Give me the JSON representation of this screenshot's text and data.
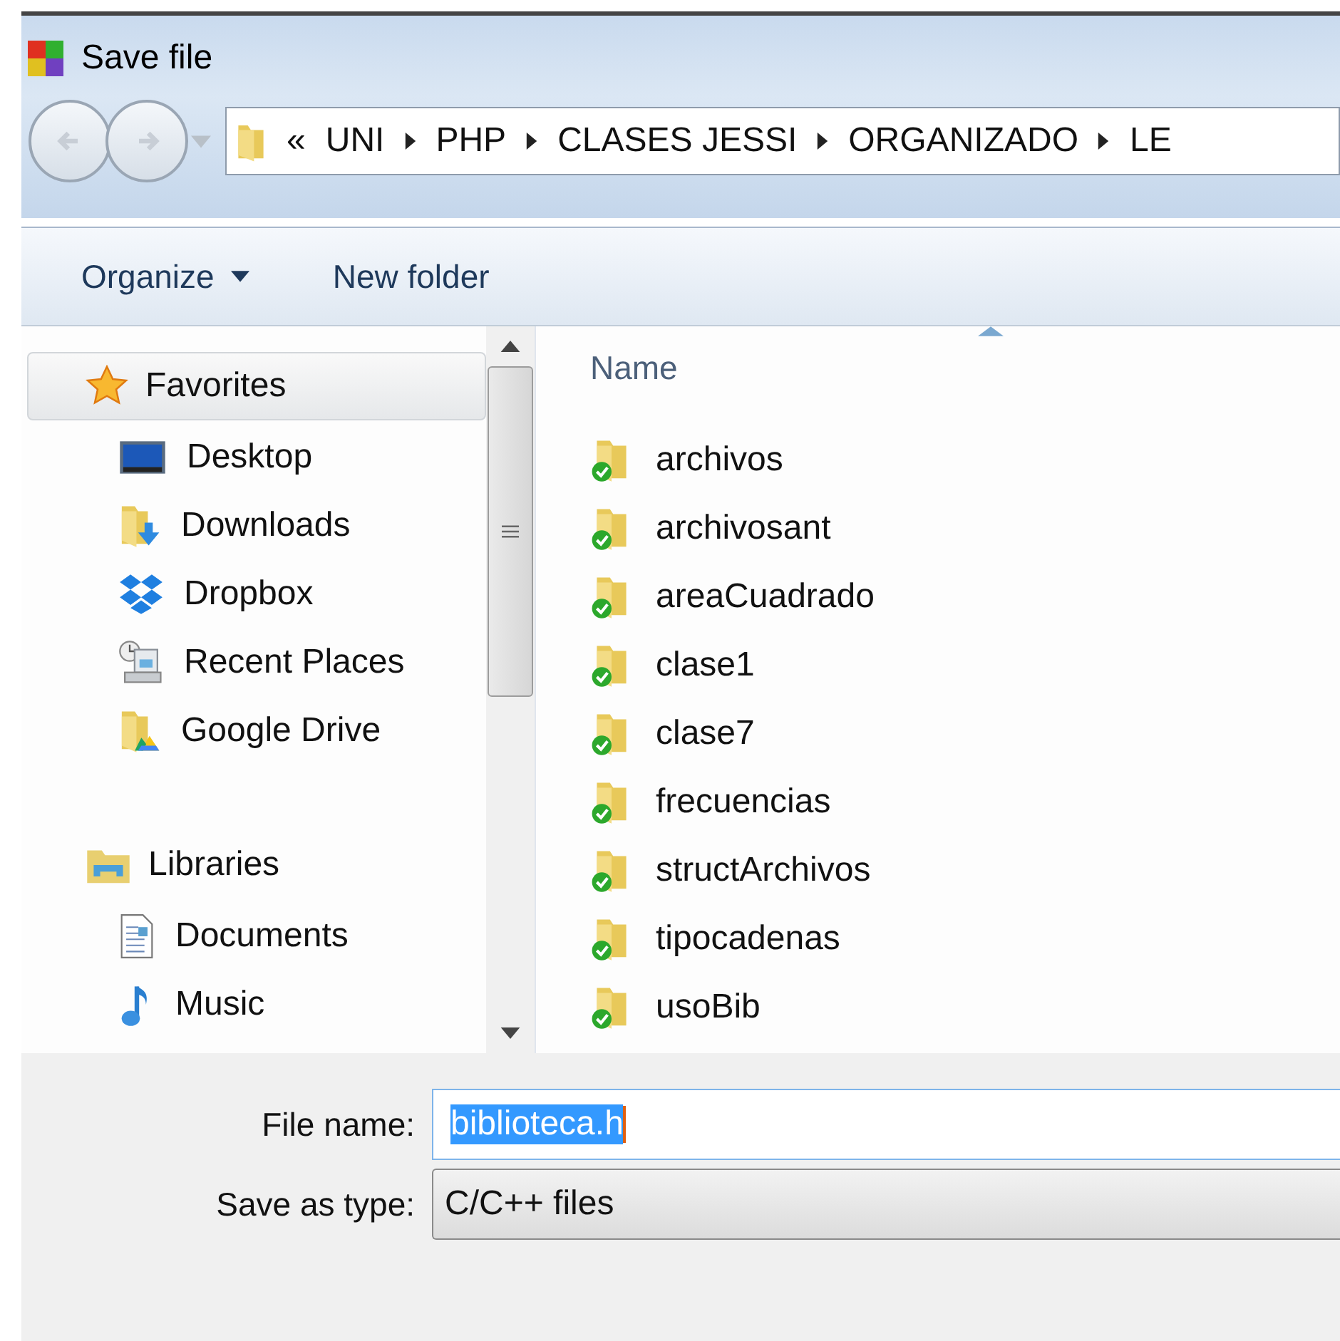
{
  "window": {
    "title": "Save file"
  },
  "address": {
    "overflow": "«",
    "path": [
      "UNI",
      "PHP",
      "CLASES JESSI",
      "ORGANIZADO",
      "LE"
    ]
  },
  "toolbar": [
    {
      "label": "Organize",
      "has_menu": true
    },
    {
      "label": "New folder",
      "has_menu": false
    }
  ],
  "sidebar": {
    "sections": [
      {
        "label": "Favorites",
        "kind": "favorites",
        "selected": true,
        "items": [
          {
            "label": "Desktop",
            "kind": "desktop"
          },
          {
            "label": "Downloads",
            "kind": "downloads"
          },
          {
            "label": "Dropbox",
            "kind": "dropbox"
          },
          {
            "label": "Recent Places",
            "kind": "recent"
          },
          {
            "label": "Google Drive",
            "kind": "drive"
          }
        ]
      },
      {
        "label": "Libraries",
        "kind": "libraries",
        "selected": false,
        "items": [
          {
            "label": "Documents",
            "kind": "documents"
          },
          {
            "label": "Music",
            "kind": "music"
          }
        ]
      }
    ]
  },
  "file_list": {
    "columns": [
      "Name"
    ],
    "items": [
      {
        "name": "archivos"
      },
      {
        "name": "archivosant"
      },
      {
        "name": "areaCuadrado"
      },
      {
        "name": "clase1"
      },
      {
        "name": "clase7"
      },
      {
        "name": "frecuencias"
      },
      {
        "name": "structArchivos"
      },
      {
        "name": "tipocadenas"
      },
      {
        "name": "usoBib"
      }
    ]
  },
  "file_name": {
    "label": "File name:",
    "value": "biblioteca.h"
  },
  "save_as_type": {
    "label": "Save as type:",
    "value": "C/C++ files"
  }
}
